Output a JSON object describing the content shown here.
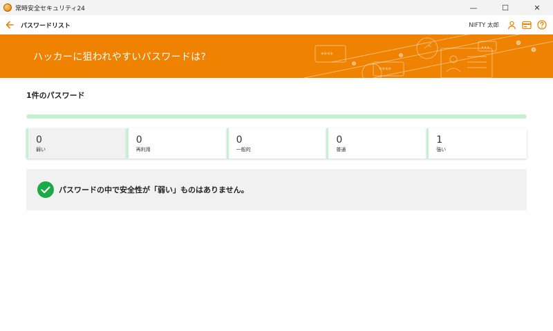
{
  "window": {
    "app_title": "常時安全セキュリティ24",
    "minimize_glyph": "—",
    "maximize_glyph": "☐",
    "close_glyph": "✕"
  },
  "header": {
    "title": "パスワードリスト",
    "user_name": "NIFTY 太郎",
    "icons": [
      "back-arrow-icon",
      "user-icon",
      "card-icon",
      "help-icon"
    ]
  },
  "banner": {
    "text": "ハッカーに狙われやすいパスワードは?",
    "color": "#ef8200"
  },
  "main": {
    "count_title": "1件のパスワード",
    "progress_fraction": 1.0,
    "progress_color": "#c6efd4",
    "stats": [
      {
        "value": "0",
        "label": "弱い"
      },
      {
        "value": "0",
        "label": "再利用"
      },
      {
        "value": "0",
        "label": "一般的"
      },
      {
        "value": "0",
        "label": "普通"
      },
      {
        "value": "1",
        "label": "強い"
      }
    ],
    "notice_text": "パスワードの中で安全性が「弱い」ものはありません。",
    "notice_icon": "check-circle-icon",
    "success_color": "#1aab47"
  },
  "colors": {
    "accent": "#ef8200",
    "strong_bar": "#c6efd4"
  }
}
